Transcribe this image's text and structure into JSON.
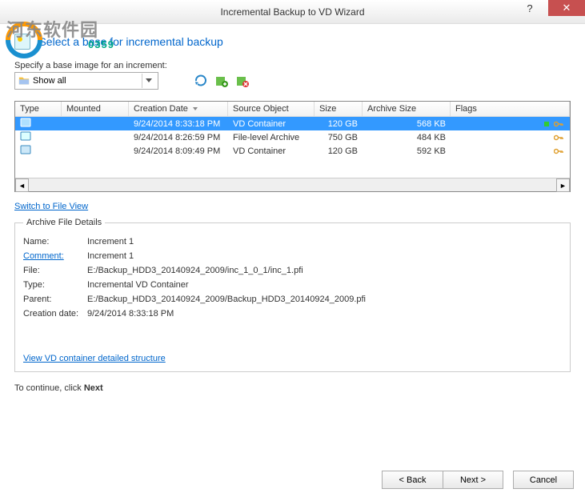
{
  "window": {
    "title": "Incremental Backup to VD Wizard",
    "help": "?",
    "close": "✕"
  },
  "watermark": {
    "text1": "河东软件园",
    "text2": "0359"
  },
  "heading": "Select a base for incremental backup",
  "specify_label": "Specify a base image for an increment:",
  "dropdown": {
    "value": "Show all"
  },
  "table": {
    "headers": {
      "type": "Type",
      "mounted": "Mounted",
      "date": "Creation Date",
      "source": "Source Object",
      "size": "Size",
      "archive": "Archive Size",
      "flags": "Flags"
    },
    "rows": [
      {
        "date": "9/24/2014 8:33:18 PM",
        "source": "VD Container",
        "size": "120 GB",
        "archive": "568 KB",
        "selected": true,
        "icon": "vd",
        "flag_green": true
      },
      {
        "date": "9/24/2014 8:26:59 PM",
        "source": "File-level Archive",
        "size": "750 GB",
        "archive": "484 KB",
        "selected": false,
        "icon": "file",
        "flag_green": false
      },
      {
        "date": "9/24/2014 8:09:49 PM",
        "source": "VD Container",
        "size": "120 GB",
        "archive": "592 KB",
        "selected": false,
        "icon": "vd",
        "flag_green": false
      }
    ]
  },
  "switch_link": "Switch to File View",
  "details": {
    "legend": "Archive File Details",
    "name_label": "Name:",
    "name": "Increment 1",
    "comment_label": "Comment:",
    "comment": "Increment 1",
    "file_label": "File:",
    "file": "E:/Backup_HDD3_20140924_2009/inc_1_0_1/inc_1.pfi",
    "type_label": "Type:",
    "type": "Incremental VD Container",
    "parent_label": "Parent:",
    "parent": "E:/Backup_HDD3_20140924_2009/Backup_HDD3_20140924_2009.pfi",
    "cdate_label": "Creation date:",
    "cdate": "9/24/2014 8:33:18 PM",
    "view_link": "View VD container detailed structure"
  },
  "footer_prefix": "To continue, click ",
  "footer_bold": "Next",
  "buttons": {
    "back": "< Back",
    "next": "Next >",
    "cancel": "Cancel"
  }
}
